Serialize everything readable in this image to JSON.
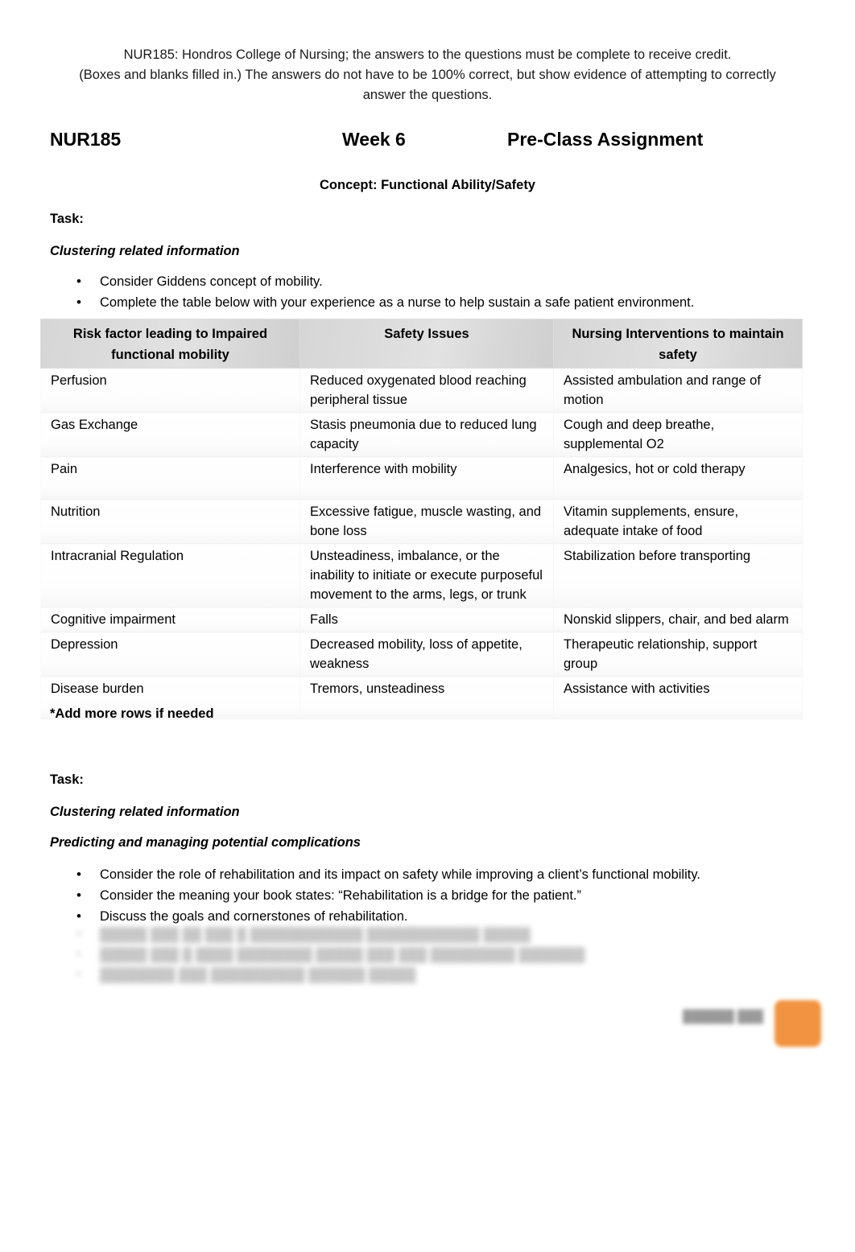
{
  "header_note": {
    "line1": "NUR185: Hondros College of Nursing; the answers to the questions must be complete to receive credit.",
    "line2": "(Boxes and blanks filled in.) The answers do not have to be 100% correct, but show evidence of attempting to correctly",
    "line3": "answer the questions."
  },
  "title": {
    "course": "NUR185",
    "week": "Week 6",
    "assignment": "Pre-Class Assignment"
  },
  "concept": "Concept: Functional Ability/Safety",
  "task1": {
    "task_label": "Task:",
    "subtitle": "Clustering related information",
    "bullets": [
      "Consider Giddens concept of mobility.",
      "Complete the table below with your experience as a nurse to help sustain a safe patient environment."
    ]
  },
  "table": {
    "headers": [
      "Risk factor leading to Impaired functional mobility",
      "Safety Issues",
      "Nursing Interventions to maintain safety"
    ],
    "rows": [
      {
        "risk_factor": "Perfusion",
        "safety_issues": "Reduced oxygenated blood reaching peripheral tissue",
        "interventions": "Assisted ambulation and range of motion"
      },
      {
        "risk_factor": "Gas Exchange",
        "safety_issues": "Stasis pneumonia due to reduced lung capacity",
        "interventions": "Cough and deep breathe, supplemental O2"
      },
      {
        "risk_factor": "Pain",
        "safety_issues": "Interference with mobility",
        "interventions": "Analgesics, hot or cold therapy"
      },
      {
        "risk_factor": "Nutrition",
        "safety_issues": "Excessive fatigue, muscle wasting, and bone loss",
        "interventions": "Vitamin supplements, ensure, adequate intake of food"
      },
      {
        "risk_factor": "Intracranial Regulation",
        "safety_issues": "Unsteadiness, imbalance, or the inability to initiate or execute purposeful movement to the arms, legs, or trunk",
        "interventions": "Stabilization before transporting"
      },
      {
        "risk_factor": "Cognitive impairment",
        "safety_issues": "Falls",
        "interventions": "Nonskid slippers, chair, and bed alarm"
      },
      {
        "risk_factor": "Depression",
        "safety_issues": "Decreased mobility, loss of appetite, weakness",
        "interventions": "Therapeutic relationship, support group"
      },
      {
        "risk_factor": "Disease burden",
        "safety_issues": "Tremors, unsteadiness",
        "interventions": "Assistance with activities"
      }
    ],
    "footnote": "*Add more rows if needed"
  },
  "task2": {
    "task_label": "Task:",
    "subtitle1": "Clustering related information",
    "subtitle2": "Predicting and managing potential complications",
    "bullets": [
      "Consider the role of rehabilitation and its impact on safety while improving a client’s functional mobility.",
      "Consider the meaning your book states: “Rehabilitation is a bridge for the patient.”",
      "Discuss the goals and cornerstones of rehabilitation."
    ],
    "obscured_bullets": [
      "█████ ███ ██ ███ █ ████████████ ████████████ █████",
      "█████ ███ █ ████ ████████ █████ ███ ███ █████████ ███████",
      "████████ ███ ██████████ ██████ █████"
    ]
  },
  "bottom_badge": {
    "label": "██████ ███",
    "color": "#f08a30"
  },
  "bullet_glyph": "•"
}
